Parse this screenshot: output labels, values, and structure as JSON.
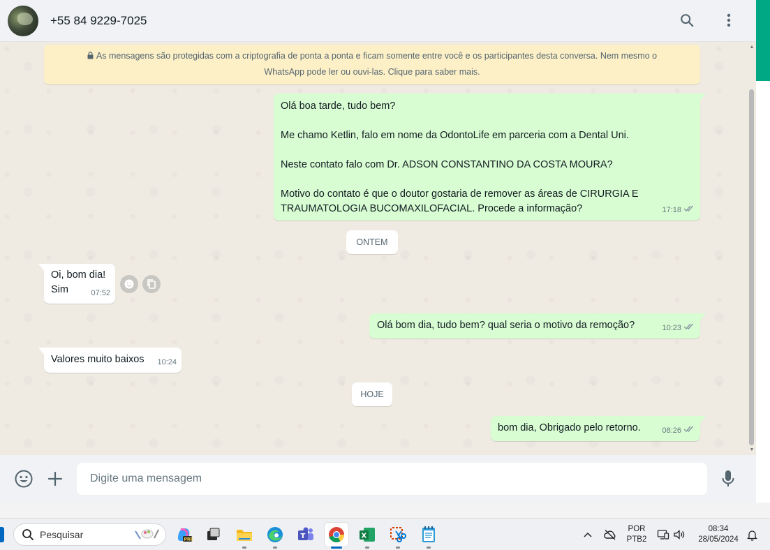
{
  "header": {
    "contact_name": "+55 84 9229-7025"
  },
  "encryption_notice": {
    "line1": "As mensagens são protegidas com a criptografia de ponta a ponta e ficam somente entre você e os participantes desta conversa. Nem mesmo o",
    "line2": "WhatsApp pode ler ou ouvi-las. Clique para saber mais."
  },
  "messages": [
    {
      "direction": "out",
      "text": "Olá boa tarde, tudo bem?\n\nMe chamo Ketlin, falo em nome da OdontoLife em parceria com a Dental Uni.\n\nNeste contato falo com Dr. ADSON CONSTANTINO DA COSTA MOURA?\n\nMotivo do contato é que o doutor gostaria de remover as áreas de CIRURGIA E\nTRAUMATOLOGIA BUCOMAXILOFACIAL. Procede a informação?",
      "time": "17:18",
      "status": "read"
    },
    {
      "direction": "in",
      "text": "Oi, bom dia!\nSim",
      "time": "07:52"
    },
    {
      "direction": "out",
      "text": "Olá bom dia, tudo bem? qual seria o motivo da remoção?",
      "time": "10:23",
      "status": "read"
    },
    {
      "direction": "in",
      "text": "Valores muito baixos",
      "time": "10:24"
    },
    {
      "direction": "out",
      "text": "bom dia, Obrigado pelo retorno.",
      "time": "08:26",
      "status": "read"
    }
  ],
  "date_chips": {
    "yesterday": "ONTEM",
    "today": "HOJE"
  },
  "composer": {
    "placeholder": "Digite uma mensagem"
  },
  "taskbar": {
    "search_label": "Pesquisar",
    "apps": [
      "copilot-icon",
      "task-view-icon",
      "file-explorer-icon",
      "edge-icon",
      "teams-icon",
      "chrome-icon",
      "excel-icon",
      "snipping-tool-icon",
      "notepad-icon"
    ],
    "active_app": "chrome-icon",
    "language": "POR",
    "keyboard_layout": "PTB2",
    "time": "08:34",
    "date": "28/05/2024"
  },
  "colors": {
    "outgoing_bubble": "#d9fdd3",
    "incoming_bubble": "#ffffff",
    "chat_background": "#efeae2",
    "accent": "#00a884",
    "read_ticks": "#53bdeb"
  }
}
